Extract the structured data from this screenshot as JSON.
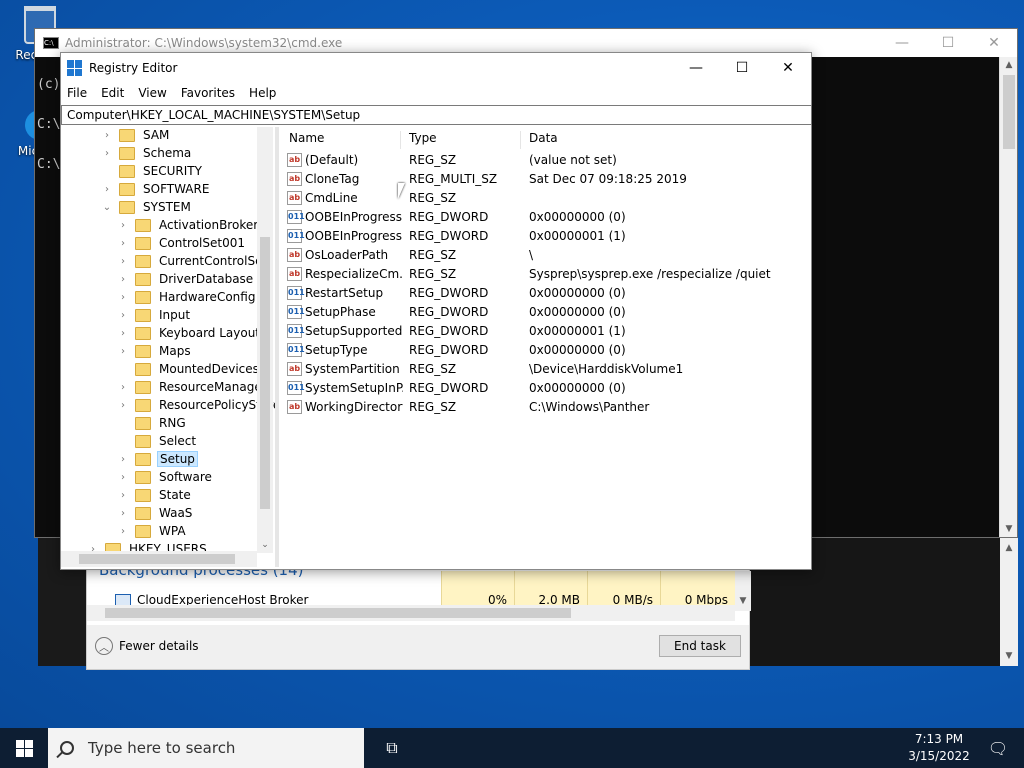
{
  "desktop": {
    "recycle_label": "RecyMic",
    "edge_label": "Micr Ed"
  },
  "cmd": {
    "title": "Administrator: C:\\Windows\\system32\\cmd.exe",
    "lines": [
      "",
      "(c)",
      "",
      "C:\\",
      "",
      "C:\\"
    ]
  },
  "taskmgr": {
    "section": "Background processes (14)",
    "process_name": "CloudExperienceHost Broker",
    "cpu": "0%",
    "memory": "2.0 MB",
    "disk": "0 MB/s",
    "network": "0 Mbps",
    "fewer_details": "Fewer details",
    "end_task": "End task"
  },
  "regedit": {
    "title": "Registry Editor",
    "menu": [
      "File",
      "Edit",
      "View",
      "Favorites",
      "Help"
    ],
    "address": "Computer\\HKEY_LOCAL_MACHINE\\SYSTEM\\Setup",
    "tree": [
      {
        "label": "SAM",
        "level": 1,
        "chev": "›"
      },
      {
        "label": "Schema",
        "level": 1,
        "chev": "›"
      },
      {
        "label": "SECURITY",
        "level": 1,
        "chev": ""
      },
      {
        "label": "SOFTWARE",
        "level": 1,
        "chev": "›"
      },
      {
        "label": "SYSTEM",
        "level": 1,
        "chev": "⌄"
      },
      {
        "label": "ActivationBroker",
        "level": 2,
        "chev": "›"
      },
      {
        "label": "ControlSet001",
        "level": 2,
        "chev": "›"
      },
      {
        "label": "CurrentControlSet",
        "level": 2,
        "chev": "›"
      },
      {
        "label": "DriverDatabase",
        "level": 2,
        "chev": "›"
      },
      {
        "label": "HardwareConfig",
        "level": 2,
        "chev": "›"
      },
      {
        "label": "Input",
        "level": 2,
        "chev": "›"
      },
      {
        "label": "Keyboard Layout",
        "level": 2,
        "chev": "›"
      },
      {
        "label": "Maps",
        "level": 2,
        "chev": "›"
      },
      {
        "label": "MountedDevices",
        "level": 2,
        "chev": ""
      },
      {
        "label": "ResourceManager",
        "level": 2,
        "chev": "›"
      },
      {
        "label": "ResourcePolicyStore",
        "level": 2,
        "chev": "›"
      },
      {
        "label": "RNG",
        "level": 2,
        "chev": ""
      },
      {
        "label": "Select",
        "level": 2,
        "chev": ""
      },
      {
        "label": "Setup",
        "level": 2,
        "chev": "›",
        "selected": true
      },
      {
        "label": "Software",
        "level": 2,
        "chev": "›"
      },
      {
        "label": "State",
        "level": 2,
        "chev": "›"
      },
      {
        "label": "WaaS",
        "level": 2,
        "chev": "›"
      },
      {
        "label": "WPA",
        "level": 2,
        "chev": "›"
      },
      {
        "label": "HKEY_USERS",
        "level": 0,
        "chev": "›"
      }
    ],
    "columns": {
      "name": "Name",
      "type": "Type",
      "data": "Data"
    },
    "values": [
      {
        "icon": "sz",
        "name": "(Default)",
        "type": "REG_SZ",
        "data": "(value not set)"
      },
      {
        "icon": "sz",
        "name": "CloneTag",
        "type": "REG_MULTI_SZ",
        "data": "Sat Dec 07 09:18:25 2019"
      },
      {
        "icon": "sz",
        "name": "CmdLine",
        "type": "REG_SZ",
        "data": ""
      },
      {
        "icon": "dw",
        "name": "OOBEInProgress",
        "type": "REG_DWORD",
        "data": "0x00000000 (0)"
      },
      {
        "icon": "dw",
        "name": "OOBEInProgress...",
        "type": "REG_DWORD",
        "data": "0x00000001 (1)"
      },
      {
        "icon": "sz",
        "name": "OsLoaderPath",
        "type": "REG_SZ",
        "data": "\\"
      },
      {
        "icon": "sz",
        "name": "RespecializeCm...",
        "type": "REG_SZ",
        "data": "Sysprep\\sysprep.exe /respecialize /quiet"
      },
      {
        "icon": "dw",
        "name": "RestartSetup",
        "type": "REG_DWORD",
        "data": "0x00000000 (0)"
      },
      {
        "icon": "dw",
        "name": "SetupPhase",
        "type": "REG_DWORD",
        "data": "0x00000000 (0)"
      },
      {
        "icon": "dw",
        "name": "SetupSupported",
        "type": "REG_DWORD",
        "data": "0x00000001 (1)"
      },
      {
        "icon": "dw",
        "name": "SetupType",
        "type": "REG_DWORD",
        "data": "0x00000000 (0)"
      },
      {
        "icon": "sz",
        "name": "SystemPartition",
        "type": "REG_SZ",
        "data": "\\Device\\HarddiskVolume1"
      },
      {
        "icon": "dw",
        "name": "SystemSetupInP...",
        "type": "REG_DWORD",
        "data": "0x00000000 (0)"
      },
      {
        "icon": "sz",
        "name": "WorkingDirectory",
        "type": "REG_SZ",
        "data": "C:\\Windows\\Panther"
      }
    ]
  },
  "taskbar": {
    "search_placeholder": "Type here to search",
    "time": "7:13 PM",
    "date": "3/15/2022"
  }
}
